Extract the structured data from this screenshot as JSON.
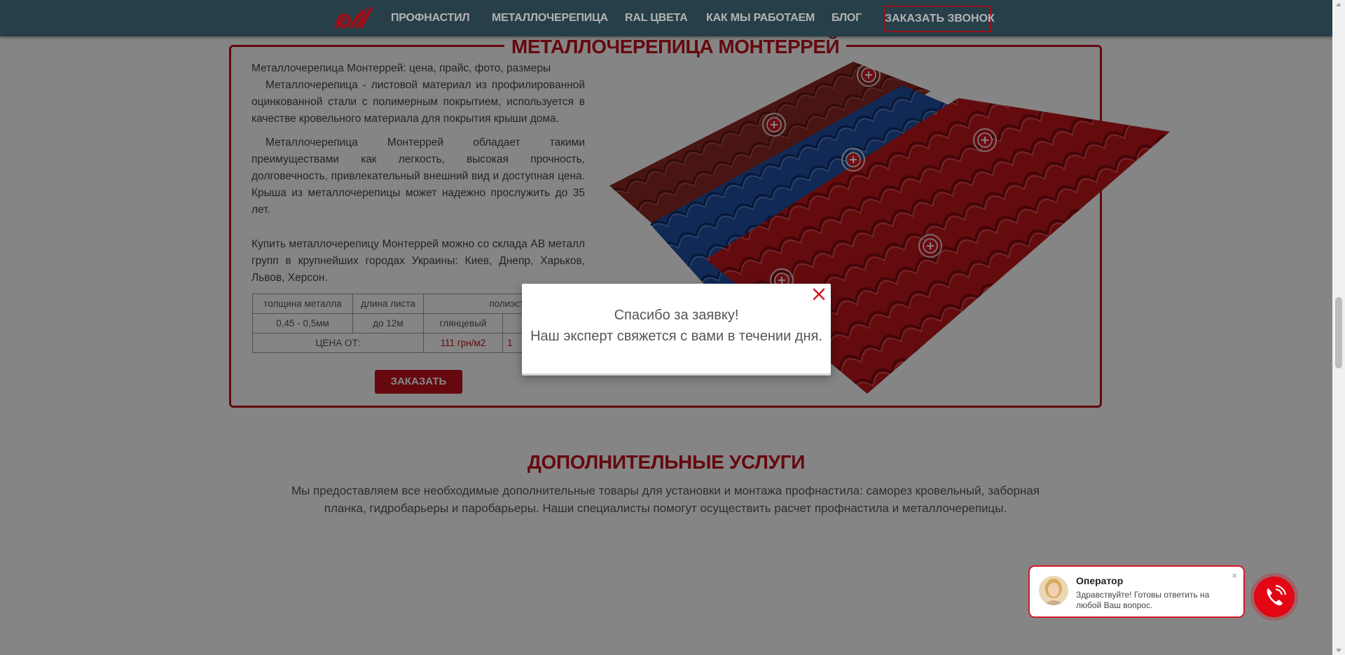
{
  "nav": {
    "items": [
      "ПРОФНАСТИЛ",
      "МЕТАЛЛОЧЕРЕПИЦА",
      "RAL ЦВЕТА",
      "КАК МЫ РАБОТАЕМ",
      "БЛОГ"
    ],
    "cta": "ЗАКАЗАТЬ ЗВОНОК"
  },
  "product": {
    "title": "МЕТАЛЛОЧЕРЕПИЦА МОНТЕРРЕЙ",
    "lead": "Металлочерепица Монтеррей: цена, прайс, фото, размеры",
    "p1": "Металлочерепица - листовой материал из профилированной оцинкованной стали с полимерным покрытием, используется в качестве кровельного материала для покрытия крыши дома.",
    "p2": "Металлочерепица Монтеррей обладает такими преимуществами как легкость, высокая прочность, долговечность, привлекательный внешний вид и доступная цена. Крыша из металлочерепицы может надежно прослужить до 35 лет.",
    "p3": "Купить металлочерепицу Монтеррей можно со склада АВ металл групп в крупнейших городах Украины: Киев, Днепр, Харьков, Львов, Херсон.",
    "table": {
      "h_thickness": "толщина металла",
      "h_length": "длина листа",
      "h_coating": "полиэстр",
      "v_thickness": "0,45 - 0,5мм",
      "v_length": "до 12м",
      "v_glossy": "глянцевый",
      "price_label": "ЦЕНА ОТ:",
      "price_value": "111 грн/м2",
      "price_partial": "1"
    },
    "order_button": "ЗАКАЗАТЬ"
  },
  "services": {
    "title": "ДОПОЛНИТЕЛЬНЫЕ УСЛУГИ",
    "text": "Мы предоставляем все необходимые дополнительные товары для установки и монтажа профнастила: саморез кровельный, заборная планка, гидробарьеры и паробарьеры. Наши специалисты помогут осуществить расчет профнастила и металлочерепицы."
  },
  "modal": {
    "line1": "Спасибо за заявку!",
    "line2": "Наш эксперт свяжется с вами в течении дня."
  },
  "chat": {
    "name": "Оператор",
    "message": "Здравствуйте! Готовы ответить на любой Ваш вопрос.",
    "close": "×"
  },
  "colors": {
    "nav_bg": "#375b69",
    "accent": "#c1121d",
    "call_button": "#e30613",
    "roof_brown": "#8a2a26",
    "roof_blue": "#1f4fa3",
    "roof_red": "#c0161c"
  }
}
